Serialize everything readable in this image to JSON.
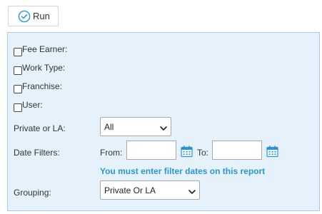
{
  "toolbar": {
    "run_label": "Run",
    "run_icon": "check-circle-icon",
    "accent": "#2a96d4"
  },
  "filters": {
    "checkboxes": [
      {
        "label": "Fee Earner:",
        "checked": false
      },
      {
        "label": "Work Type:",
        "checked": false
      },
      {
        "label": "Franchise:",
        "checked": false
      },
      {
        "label": "User:",
        "checked": false
      }
    ],
    "private_or_la": {
      "label": "Private or LA:",
      "selected": "All"
    },
    "date_filters": {
      "label": "Date Filters:",
      "from_label": "From:",
      "from_value": "",
      "to_label": "To:",
      "to_value": "",
      "calendar_icon": "calendar-icon",
      "warning": "You must enter filter dates on this report"
    },
    "grouping": {
      "label": "Grouping:",
      "selected": "Private Or LA"
    }
  },
  "colors": {
    "panel_background": "#e6f2fb",
    "panel_border": "#a9cbe8",
    "warning_text": "#2a96d4"
  }
}
